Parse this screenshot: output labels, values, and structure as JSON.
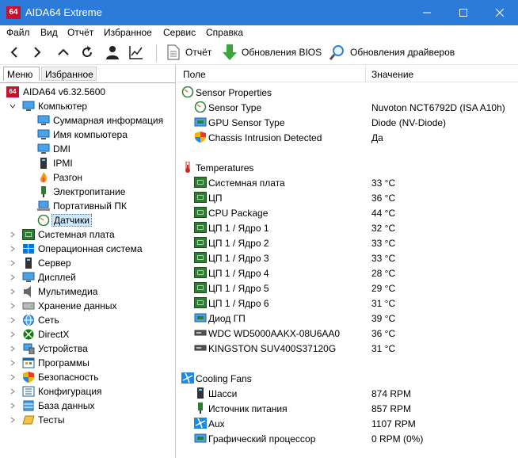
{
  "window": {
    "app_logo": "64",
    "title": "AIDA64 Extreme"
  },
  "menu": [
    "Файл",
    "Вид",
    "Отчёт",
    "Избранное",
    "Сервис",
    "Справка"
  ],
  "toolbar": {
    "report_label": "Отчёт",
    "bios_update_label": "Обновления BIOS",
    "driver_update_label": "Обновления драйверов"
  },
  "left_tabs": {
    "menu": "Меню",
    "favorites": "Избранное"
  },
  "tree": {
    "root": "AIDA64 v6.32.5600",
    "computer": "Компьютер",
    "computer_children": [
      "Суммарная информация",
      "Имя компьютера",
      "DMI",
      "IPMI",
      "Разгон",
      "Электропитание",
      "Портативный ПК",
      "Датчики"
    ],
    "top_items": [
      "Системная плата",
      "Операционная система",
      "Сервер",
      "Дисплей",
      "Мультимедиа",
      "Хранение данных",
      "Сеть",
      "DirectX",
      "Устройства",
      "Программы",
      "Безопасность",
      "Конфигурация",
      "База данных",
      "Тесты"
    ]
  },
  "columns": {
    "field": "Поле",
    "value": "Значение"
  },
  "sections": {
    "sensor_properties": {
      "title": "Sensor Properties",
      "rows": [
        {
          "field": "Sensor Type",
          "value": "Nuvoton NCT6792D  (ISA A10h)"
        },
        {
          "field": "GPU Sensor Type",
          "value": "Diode  (NV-Diode)"
        },
        {
          "field": "Chassis Intrusion Detected",
          "value": "Да"
        }
      ]
    },
    "temperatures": {
      "title": "Temperatures",
      "rows": [
        {
          "field": "Системная плата",
          "value": "33 °C"
        },
        {
          "field": "ЦП",
          "value": "36 °C"
        },
        {
          "field": "CPU Package",
          "value": "44 °C"
        },
        {
          "field": "ЦП 1 / Ядро 1",
          "value": "32 °C"
        },
        {
          "field": "ЦП 1 / Ядро 2",
          "value": "33 °C"
        },
        {
          "field": "ЦП 1 / Ядро 3",
          "value": "33 °C"
        },
        {
          "field": "ЦП 1 / Ядро 4",
          "value": "28 °C"
        },
        {
          "field": "ЦП 1 / Ядро 5",
          "value": "29 °C"
        },
        {
          "field": "ЦП 1 / Ядро 6",
          "value": "31 °C"
        },
        {
          "field": "Диод ГП",
          "value": "39 °C"
        },
        {
          "field": "WDC WD5000AAKX-08U6AA0",
          "value": "36 °C"
        },
        {
          "field": "KINGSTON SUV400S37120G",
          "value": "31 °C"
        }
      ]
    },
    "cooling_fans": {
      "title": "Cooling Fans",
      "rows": [
        {
          "field": "Шасси",
          "value": "874 RPM"
        },
        {
          "field": "Источник питания",
          "value": "857 RPM"
        },
        {
          "field": "Aux",
          "value": "1107 RPM"
        },
        {
          "field": "Графический процессор",
          "value": "0 RPM  (0%)"
        }
      ]
    }
  },
  "colors": {
    "titlebar": "#2d7bd9",
    "selection": "#cce8ff",
    "logo_red": "#c8102e",
    "chip_green": "#2e7d32",
    "arrow_green": "#3aa63a"
  }
}
